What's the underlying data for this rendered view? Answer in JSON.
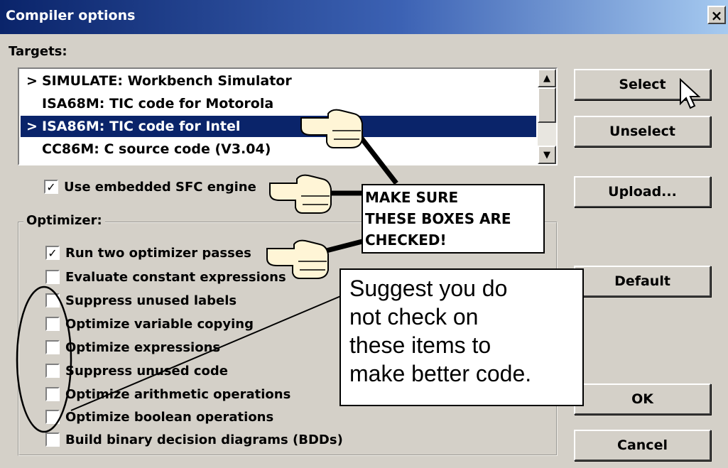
{
  "window": {
    "title": "Compiler options",
    "close_label": "×"
  },
  "targets": {
    "label": "Targets:",
    "items": [
      {
        "marker": ">",
        "label": "SIMULATE: Workbench Simulator",
        "selected": false
      },
      {
        "marker": "",
        "label": "ISA68M: TIC code for Motorola",
        "selected": false
      },
      {
        "marker": ">",
        "label": "ISA86M: TIC code for Intel",
        "selected": true
      },
      {
        "marker": "",
        "label": "CC86M: C source code (V3.04)",
        "selected": false
      }
    ],
    "scroll_up": "▲",
    "scroll_down": "▼"
  },
  "sfc": {
    "label": "Use embedded SFC engine",
    "checked": true,
    "mark": "✓"
  },
  "optimizer": {
    "label": "Optimizer:",
    "options": [
      {
        "label": "Run two optimizer passes",
        "checked": true,
        "mark": "✓"
      },
      {
        "label": "Evaluate constant expressions",
        "checked": false,
        "mark": ""
      },
      {
        "label": "Suppress unused labels",
        "checked": false,
        "mark": ""
      },
      {
        "label": "Optimize variable copying",
        "checked": false,
        "mark": ""
      },
      {
        "label": "Optimize expressions",
        "checked": false,
        "mark": ""
      },
      {
        "label": "Suppress unused code",
        "checked": false,
        "mark": ""
      },
      {
        "label": "Optimize arithmetic operations",
        "checked": false,
        "mark": ""
      },
      {
        "label": "Optimize boolean operations",
        "checked": false,
        "mark": ""
      },
      {
        "label": "Build binary decision diagrams (BDDs)",
        "checked": false,
        "mark": ""
      }
    ]
  },
  "buttons": {
    "select": "Select",
    "unselect": "Unselect",
    "upload": "Upload...",
    "default": "Default",
    "ok": "OK",
    "cancel": "Cancel"
  },
  "annotations": {
    "make_sure": [
      "MAKE SURE",
      "THESE BOXES ARE",
      "CHECKED!"
    ],
    "suggest": [
      "Suggest you do",
      "not check on",
      "these items to",
      "make better code."
    ]
  },
  "colors": {
    "dialog_bg": "#d4d0c8",
    "titlebar_start": "#0a246a",
    "titlebar_end": "#a6caf0",
    "selection_bg": "#0a246a",
    "annotation_hand": "#fff5d6"
  },
  "icons": {
    "pointer": "mouse-pointer-icon",
    "hand": "pointing-hand-icon"
  }
}
